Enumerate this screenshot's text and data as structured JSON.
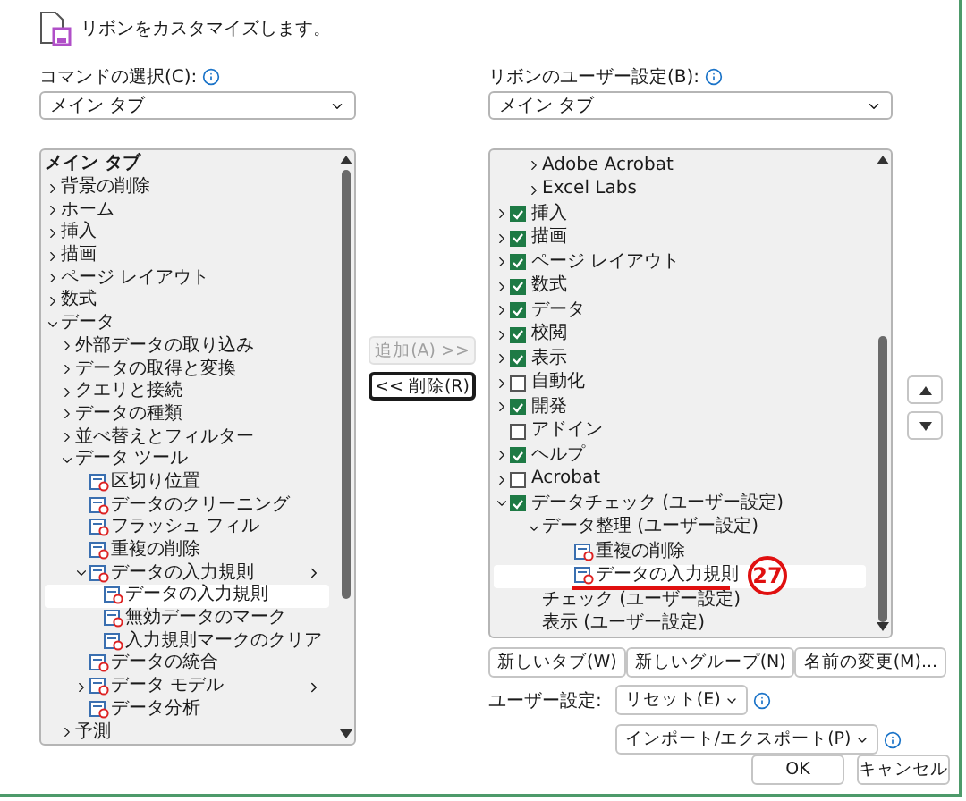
{
  "header": {
    "title": "リボンをカスタマイズします。"
  },
  "left": {
    "label": "コマンドの選択(C):",
    "dropdown": "メイン タブ",
    "list_title": "メイン タブ",
    "items": [
      {
        "label": "背景の削除",
        "kind": "group",
        "expanded": false,
        "selected": false
      },
      {
        "label": "ホーム",
        "kind": "group",
        "expanded": false,
        "selected": false
      },
      {
        "label": "挿入",
        "kind": "group",
        "expanded": false,
        "selected": false
      },
      {
        "label": "描画",
        "kind": "group",
        "expanded": false,
        "selected": false
      },
      {
        "label": "ページ レイアウト",
        "kind": "group",
        "expanded": false,
        "selected": false
      },
      {
        "label": "数式",
        "kind": "group",
        "expanded": false,
        "selected": false
      },
      {
        "label": "データ",
        "kind": "group",
        "expanded": true,
        "selected": false,
        "children": [
          {
            "label": "外部データの取り込み",
            "kind": "group",
            "expanded": false,
            "selected": false
          },
          {
            "label": "データの取得と変換",
            "kind": "group",
            "expanded": false,
            "selected": false
          },
          {
            "label": "クエリと接続",
            "kind": "group",
            "expanded": false,
            "selected": false
          },
          {
            "label": "データの種類",
            "kind": "group",
            "expanded": false,
            "selected": false
          },
          {
            "label": "並べ替えとフィルター",
            "kind": "group",
            "expanded": false,
            "selected": false
          },
          {
            "label": "データ ツール",
            "kind": "group",
            "expanded": true,
            "selected": false,
            "children": [
              {
                "label": "区切り位置",
                "kind": "command",
                "selected": false
              },
              {
                "label": "データのクリーニング",
                "kind": "command",
                "selected": false
              },
              {
                "label": "フラッシュ フィル",
                "kind": "command",
                "selected": false
              },
              {
                "label": "重複の削除",
                "kind": "command",
                "selected": false
              },
              {
                "label": "データの入力規則",
                "kind": "command",
                "expanded": true,
                "submenu": true,
                "selected": false,
                "children": [
                  {
                    "label": "データの入力規則",
                    "kind": "command",
                    "selected": true
                  },
                  {
                    "label": "無効データのマーク",
                    "kind": "command",
                    "selected": false
                  },
                  {
                    "label": "入力規則マークのクリア",
                    "kind": "command",
                    "selected": false
                  }
                ]
              },
              {
                "label": "データの統合",
                "kind": "command",
                "selected": false
              },
              {
                "label": "データ モデル",
                "kind": "command",
                "expanded": false,
                "submenu": true,
                "selected": false
              },
              {
                "label": "データ分析",
                "kind": "command",
                "selected": false
              }
            ]
          },
          {
            "label": "予測",
            "kind": "group",
            "expanded": false,
            "selected": false
          }
        ]
      }
    ]
  },
  "middle_buttons": [
    {
      "label": "追加(A) >>",
      "disabled": true,
      "focused": false
    },
    {
      "label": "<< 削除(R)",
      "disabled": false,
      "focused": true
    }
  ],
  "right": {
    "label": "リボンのユーザー設定(B):",
    "dropdown": "メイン タブ",
    "continued_items": [
      {
        "label": "Adobe Acrobat",
        "kind": "group",
        "expanded": false,
        "selected": false
      },
      {
        "label": "Excel Labs",
        "kind": "group",
        "expanded": false,
        "selected": false
      }
    ],
    "items": [
      {
        "label": "挿入",
        "kind": "tab",
        "expanded": false,
        "checked": true,
        "selected": false
      },
      {
        "label": "描画",
        "kind": "tab",
        "expanded": false,
        "checked": true,
        "selected": false
      },
      {
        "label": "ページ レイアウト",
        "kind": "tab",
        "expanded": false,
        "checked": true,
        "selected": false
      },
      {
        "label": "数式",
        "kind": "tab",
        "expanded": false,
        "checked": true,
        "selected": false
      },
      {
        "label": "データ",
        "kind": "tab",
        "expanded": false,
        "checked": true,
        "selected": false
      },
      {
        "label": "校閲",
        "kind": "tab",
        "expanded": false,
        "checked": true,
        "selected": false
      },
      {
        "label": "表示",
        "kind": "tab",
        "expanded": false,
        "checked": true,
        "selected": false
      },
      {
        "label": "自動化",
        "kind": "tab",
        "expanded": false,
        "checked": false,
        "selected": false
      },
      {
        "label": "開発",
        "kind": "tab",
        "expanded": false,
        "checked": true,
        "selected": false
      },
      {
        "label": "アドイン",
        "kind": "tab",
        "checked": false,
        "selected": false
      },
      {
        "label": "ヘルプ",
        "kind": "tab",
        "expanded": false,
        "checked": true,
        "selected": false
      },
      {
        "label": "Acrobat",
        "kind": "tab",
        "expanded": false,
        "checked": false,
        "selected": false
      },
      {
        "label": "データチェック (ユーザー設定)",
        "kind": "tab",
        "expanded": true,
        "checked": true,
        "selected": false,
        "children": [
          {
            "label": "データ整理 (ユーザー設定)",
            "kind": "group",
            "expanded": true,
            "selected": false,
            "children": [
              {
                "label": "重複の削除",
                "kind": "command",
                "selected": false
              },
              {
                "label": "データの入力規則",
                "kind": "command",
                "selected": true,
                "annotation": "27"
              }
            ]
          },
          {
            "label": "チェック (ユーザー設定)",
            "kind": "group",
            "selected": false
          },
          {
            "label": "表示 (ユーザー設定)",
            "kind": "group",
            "selected": false
          }
        ]
      }
    ],
    "buttons": [
      "新しいタブ(W)",
      "新しいグループ(N)",
      "名前の変更(M)..."
    ],
    "user_settings": {
      "label": "ユーザー設定:",
      "reset": "リセット(E)",
      "import_export": "インポート/エクスポート(P)"
    }
  },
  "footer": {
    "ok": "OK",
    "cancel": "キャンセル"
  }
}
